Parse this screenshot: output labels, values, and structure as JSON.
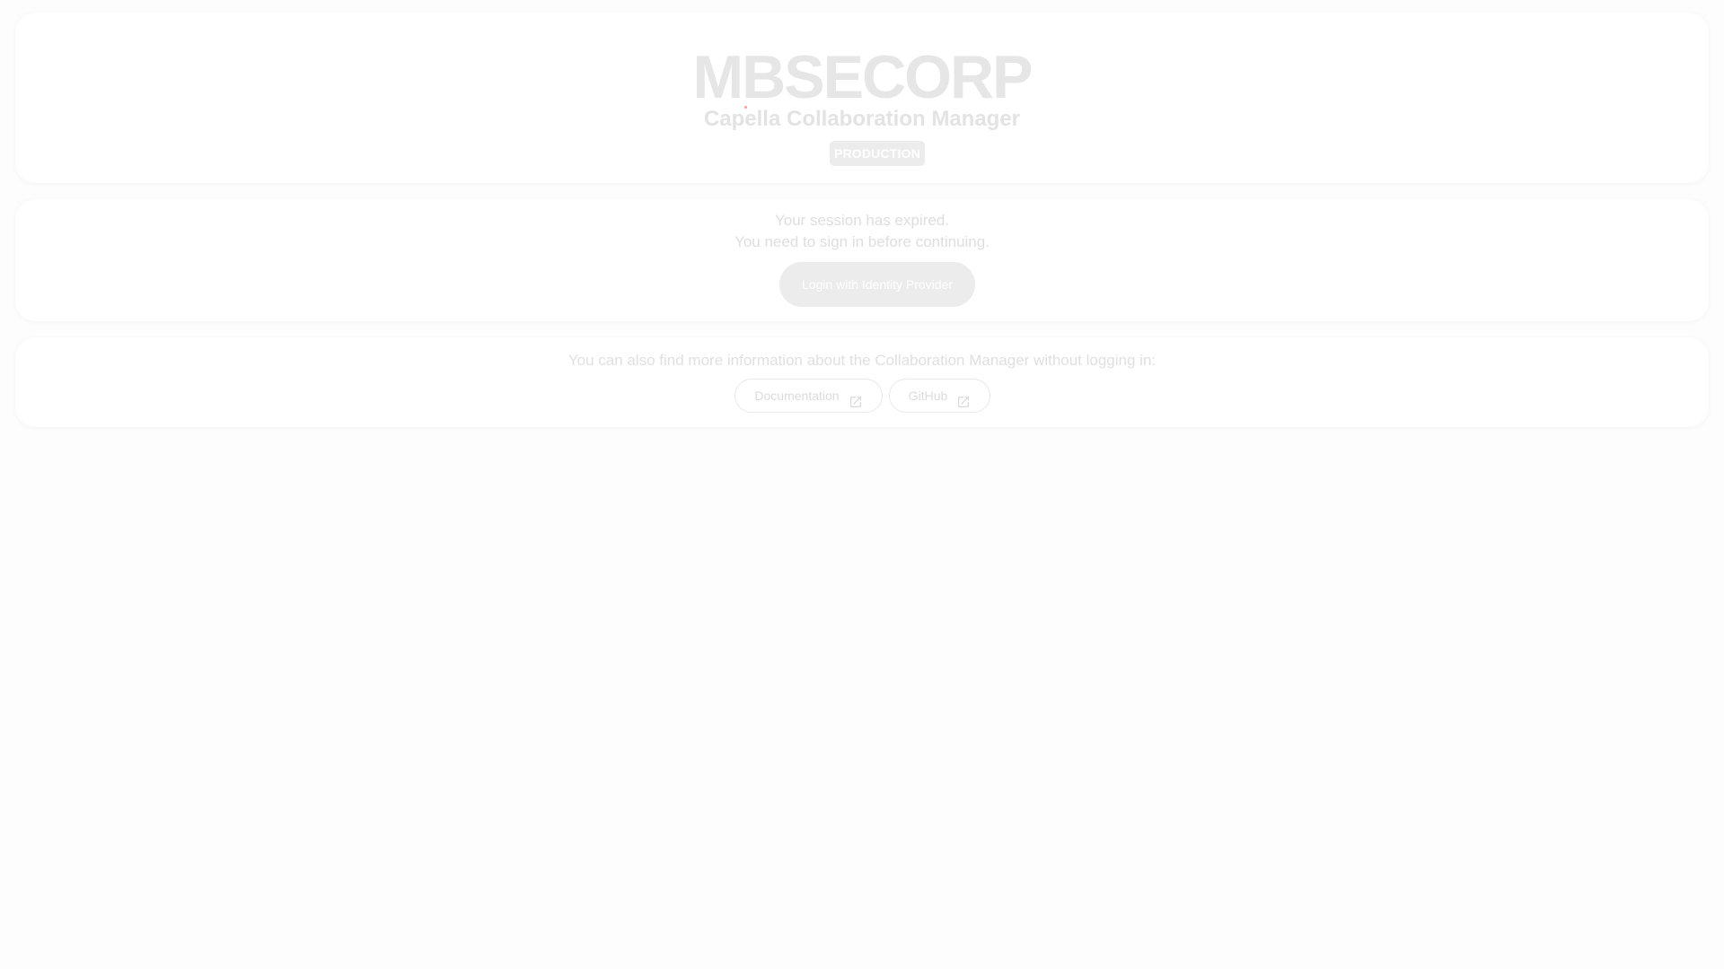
{
  "header": {
    "logo_part_1": "MBSE",
    "logo_part_2": "CORP",
    "subtitle": "Capella Collaboration Manager",
    "environment_badge": "PRODUCTION"
  },
  "session": {
    "expired_message": "Your session has expired.",
    "signin_message": "You need to sign in before continuing.",
    "login_button_label": "Login with Identity Provider"
  },
  "info": {
    "text": "You can also find more information about the Collaboration Manager without logging in:",
    "links": [
      {
        "label": "Documentation",
        "icon": "open-in-new-icon"
      },
      {
        "label": "GitHub",
        "icon": "open-in-new-icon"
      }
    ]
  },
  "colors": {
    "background": "#fdfdfd",
    "card": "#ffffff",
    "muted_text": "#dedede",
    "button_fill": "#ececec"
  }
}
